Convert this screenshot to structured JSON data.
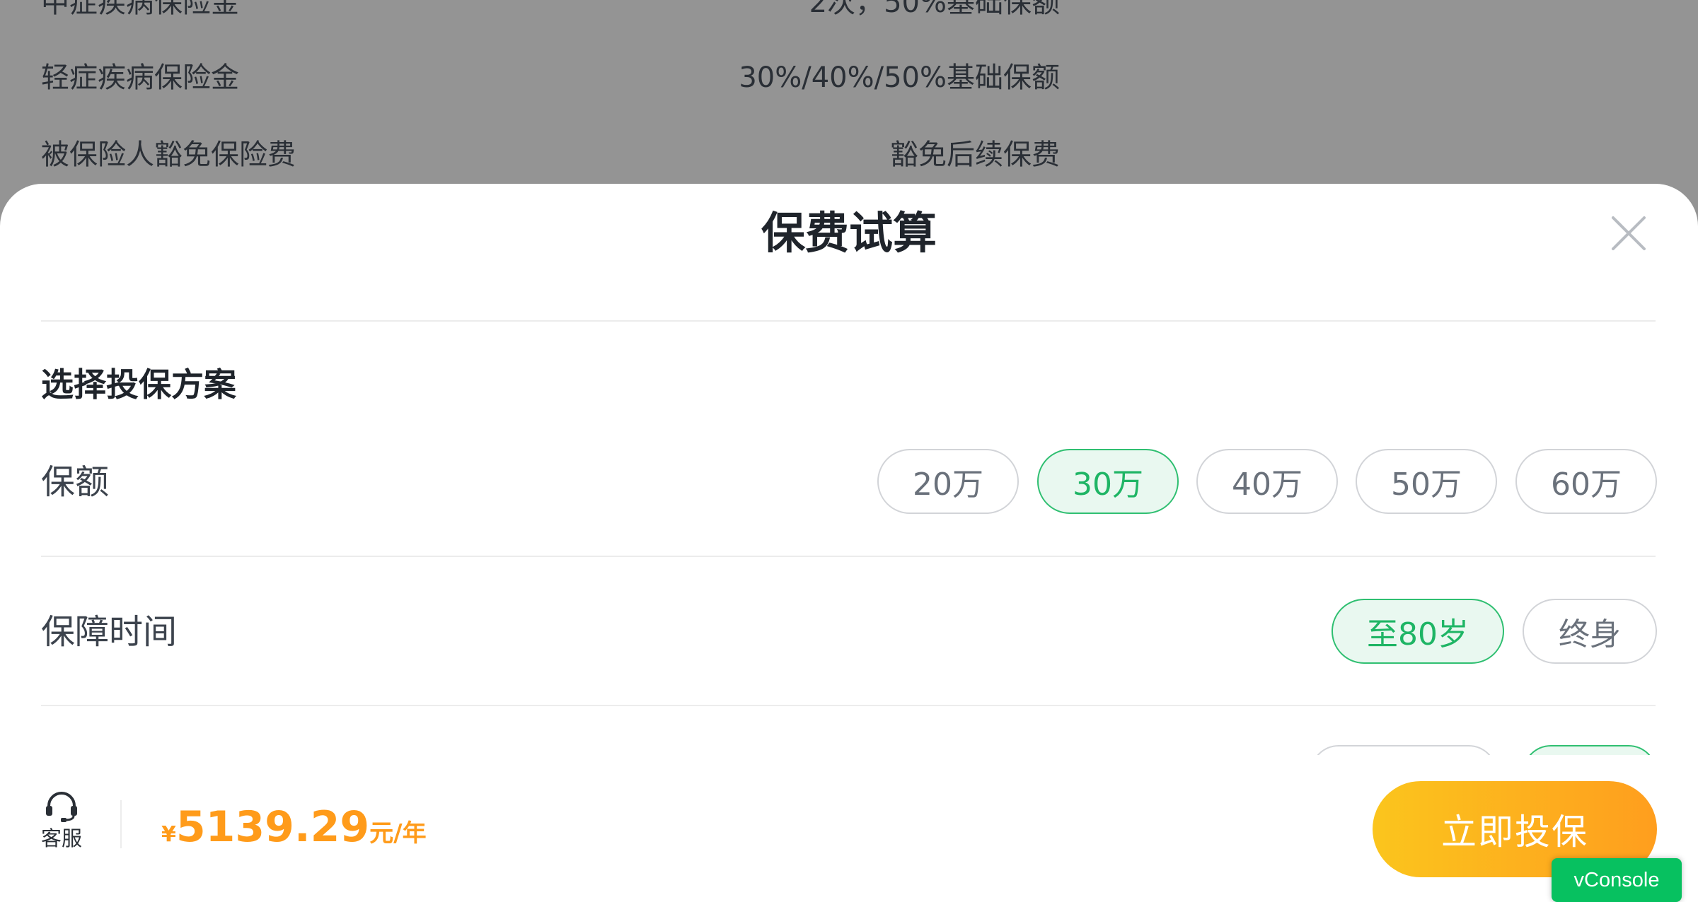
{
  "background_list": {
    "rows": [
      {
        "label": "中症疾病保险金",
        "value": "2次，50%基础保额"
      },
      {
        "label": "轻症疾病保险金",
        "value": "30%/40%/50%基础保额"
      },
      {
        "label": "被保险人豁免保险费",
        "value": "豁免后续保费"
      }
    ]
  },
  "sheet": {
    "title": "保费试算",
    "close_icon": "close-icon",
    "section_title": "选择投保方案",
    "coverage": {
      "label": "保额",
      "options": [
        "20万",
        "30万",
        "40万",
        "50万",
        "60万"
      ],
      "selected": "30万"
    },
    "term": {
      "label": "保障时间",
      "options": [
        "至80岁",
        "终身"
      ],
      "selected": "至80岁"
    }
  },
  "footer": {
    "service_icon": "headset-icon",
    "service_label": "客服",
    "price_currency": "¥",
    "price_amount": "5139.29",
    "price_unit": "元/年",
    "buy_label": "立即投保"
  },
  "vconsole_label": "vConsole",
  "colors": {
    "accent_green": "#1fb565",
    "price_orange": "#ff9b1a",
    "button_gradient_start": "#fbc51d",
    "button_gradient_end": "#ff9e1e",
    "overlay_gray": "#949494",
    "vconsole_green": "#07c160"
  }
}
